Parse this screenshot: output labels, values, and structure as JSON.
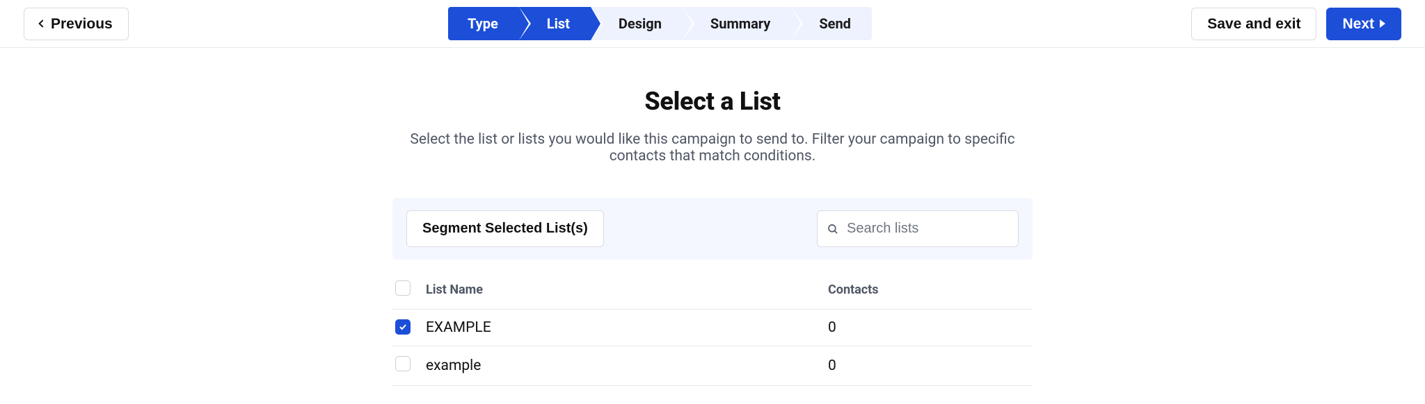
{
  "topbar": {
    "previous_label": "Previous",
    "save_exit_label": "Save and exit",
    "next_label": "Next"
  },
  "stepper": {
    "steps": [
      {
        "label": "Type",
        "active": true
      },
      {
        "label": "List",
        "active": true
      },
      {
        "label": "Design",
        "active": false
      },
      {
        "label": "Summary",
        "active": false
      },
      {
        "label": "Send",
        "active": false
      }
    ]
  },
  "page": {
    "title": "Select a List",
    "subtitle": "Select the list or lists you would like this campaign to send to. Filter your campaign to specific contacts that match conditions."
  },
  "panel": {
    "segment_label": "Segment Selected List(s)",
    "search_placeholder": "Search lists"
  },
  "table": {
    "headers": {
      "name": "List Name",
      "contacts": "Contacts"
    },
    "rows": [
      {
        "name": "EXAMPLE",
        "contacts": "0",
        "checked": true
      },
      {
        "name": "example",
        "contacts": "0",
        "checked": false
      }
    ]
  }
}
